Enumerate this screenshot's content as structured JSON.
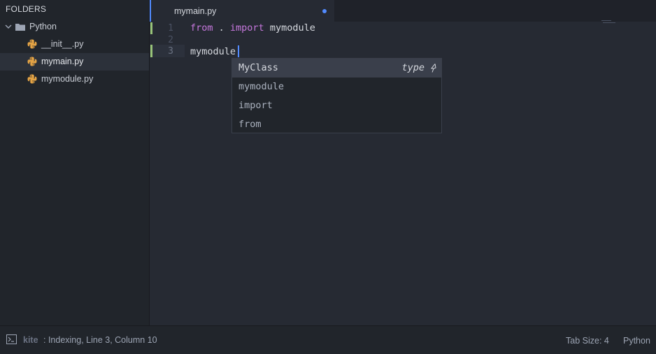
{
  "sidebar": {
    "header": "FOLDERS",
    "folder": {
      "name": "Python",
      "expanded": true,
      "icon": "folder-icon"
    },
    "files": [
      {
        "name": "__init__.py",
        "icon": "python-file-icon",
        "selected": false
      },
      {
        "name": "mymain.py",
        "icon": "python-file-icon",
        "selected": true
      },
      {
        "name": "mymodule.py",
        "icon": "python-file-icon",
        "selected": false
      }
    ]
  },
  "editor": {
    "tab": {
      "title": "mymain.py",
      "modified": true
    },
    "line_numbers": [
      "1",
      "2",
      "3"
    ],
    "lines": {
      "l1_kw_from": "from",
      "l1_dot": " . ",
      "l1_kw_import": "import",
      "l1_module": " mymodule",
      "l3_text": "mymodule."
    }
  },
  "autocomplete": {
    "items": [
      {
        "label": "MyClass",
        "type": "type",
        "selected": true
      },
      {
        "label": "mymodule",
        "selected": false
      },
      {
        "label": "import",
        "selected": false
      },
      {
        "label": "from",
        "selected": false
      }
    ]
  },
  "statusbar": {
    "brand": "kite",
    "status": ": Indexing, Line 3, Column 10",
    "tab_size": "Tab Size: 4",
    "grammar": "Python"
  },
  "colors": {
    "keyword": "#c678dd",
    "accent": "#528bff",
    "git_added": "#98c379",
    "python_icon": "#e5a445"
  }
}
